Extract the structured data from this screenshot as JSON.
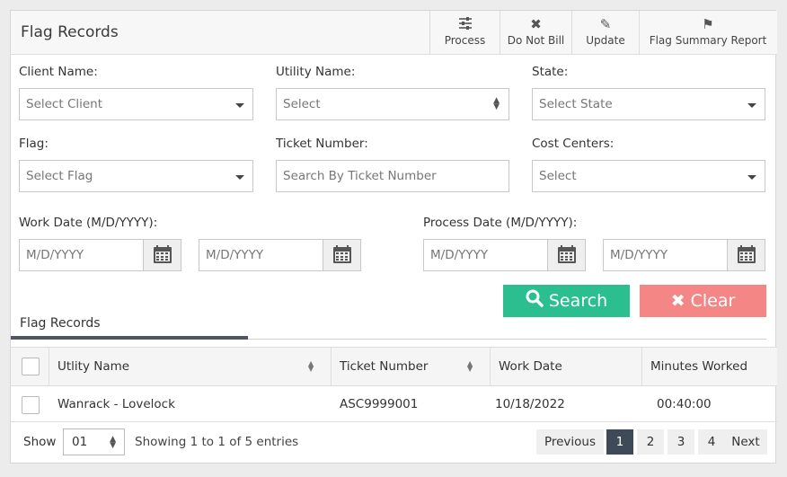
{
  "header": {
    "title": "Flag Records",
    "actions": [
      {
        "label": "Process",
        "icon": "sliders-icon"
      },
      {
        "label": "Do Not Bill",
        "icon": "close-icon"
      },
      {
        "label": "Update",
        "icon": "pencil-icon"
      },
      {
        "label": "Flag Summary Report",
        "icon": "flag-icon"
      }
    ]
  },
  "filters": {
    "client": {
      "label": "Client Name:",
      "value": "Select Client"
    },
    "utility": {
      "label": "Utility Name:",
      "value": "Select"
    },
    "state": {
      "label": "State:",
      "value": "Select State"
    },
    "flag": {
      "label": "Flag:",
      "value": "Select Flag"
    },
    "ticket": {
      "label": "Ticket Number:",
      "placeholder": "Search By Ticket Number"
    },
    "cost_centers": {
      "label": "Cost Centers:",
      "value": "Select"
    },
    "work_date": {
      "label": "Work Date (M/D/YYYY):",
      "from_placeholder": "M/D/YYYY",
      "to_placeholder": "M/D/YYYY"
    },
    "process_date": {
      "label": "Process Date (M/D/YYYY):",
      "from_placeholder": "M/D/YYYY",
      "to_placeholder": "M/D/YYYY"
    }
  },
  "buttons": {
    "search": "Search",
    "clear": "Clear"
  },
  "tab": {
    "label": "Flag Records"
  },
  "table": {
    "columns": [
      "Utlity Name",
      "Ticket Number",
      "Work Date",
      "Minutes Worked"
    ],
    "rows": [
      {
        "utility": "Wanrack - Lovelock",
        "ticket": "ASC9999001",
        "work_date": "10/18/2022",
        "minutes": "00:40:00"
      }
    ]
  },
  "footer": {
    "show_label": "Show",
    "page_size": "01",
    "info": "Showing 1 to 1 of 5 entries",
    "previous": "Previous",
    "pages": [
      "1",
      "2",
      "3",
      "4"
    ],
    "next": "Next",
    "current_page": "1"
  },
  "colors": {
    "search": "#2bbf8f",
    "clear": "#f48686",
    "active_page": "#3e4a57"
  }
}
